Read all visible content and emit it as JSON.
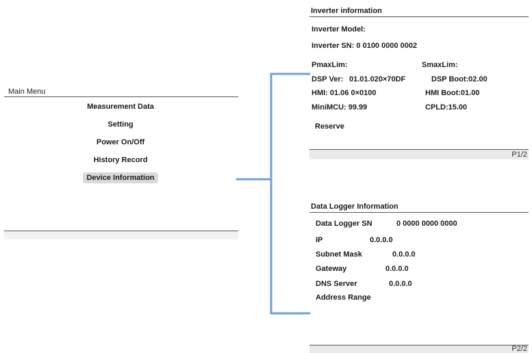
{
  "main_menu": {
    "title": "Main Menu",
    "items": [
      {
        "label": "Measurement Data"
      },
      {
        "label": "Setting"
      },
      {
        "label": "Power On/Off"
      },
      {
        "label": "History Record"
      },
      {
        "label": "Device Information",
        "selected": true
      }
    ]
  },
  "inverter_info": {
    "title": "Inverter information",
    "model_label": "Inverter  Model:",
    "sn": "Inverter SN: 0 0100 0000 0002",
    "pmaxlim": "PmaxLim:",
    "smaxlim": "SmaxLim:",
    "dsp_ver_label": "DSP Ver:",
    "dsp_ver_value": "01.01.020×70DF",
    "dsp_boot": "DSP  Boot:02.00",
    "hmi": "HMI: 01.06 0×0100",
    "hmi_boot": "HMI  Boot:01.00",
    "minimcu": "MiniMCU: 99.99",
    "cpld": "CPLD:15.00",
    "reserve": "Reserve",
    "page": "P1/2"
  },
  "logger_info": {
    "title": "Data Logger Information",
    "rows": [
      {
        "label": "Data Logger SN",
        "value": "0 0000 0000 0000"
      },
      {
        "label": "IP",
        "value": "0.0.0.0"
      },
      {
        "label": "Subnet Mask",
        "value": "0.0.0.0"
      },
      {
        "label": "Gateway",
        "value": "0.0.0.0"
      },
      {
        "label": "DNS Server",
        "value": "0.0.0.0"
      },
      {
        "label": "Address Range",
        "value": ""
      }
    ],
    "page": "P2/2"
  },
  "colors": {
    "connector": "#6f9fd8",
    "rule": "#555555",
    "footer": "#eaeaea"
  }
}
